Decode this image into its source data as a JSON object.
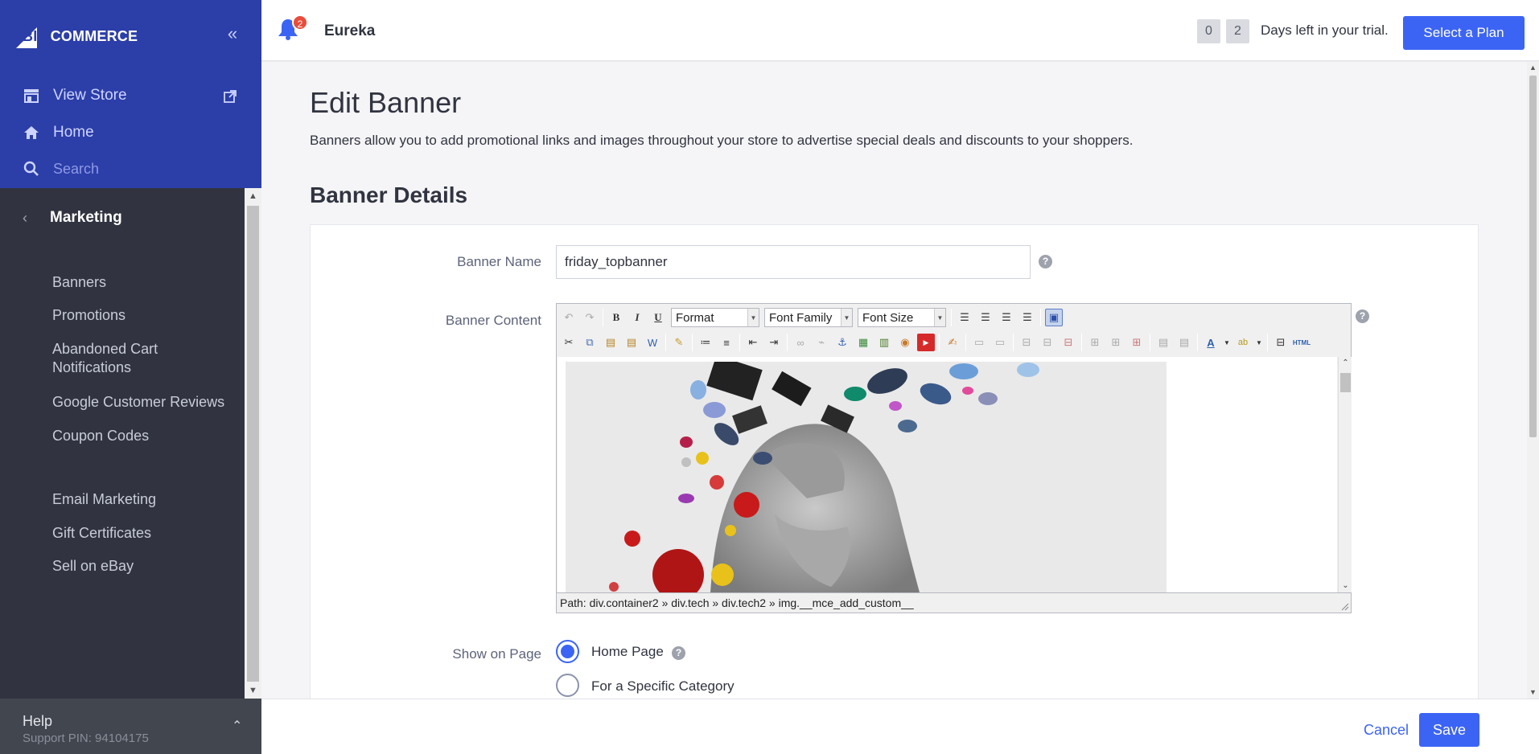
{
  "sidebar": {
    "logo_big": "BIG",
    "logo_commerce": "COMMERCE",
    "view_store": "View Store",
    "home": "Home",
    "search_placeholder": "Search",
    "section": "Marketing",
    "items": [
      "Banners",
      "Promotions",
      "Abandoned Cart",
      "Notifications",
      "Google Customer Reviews",
      "Coupon Codes",
      "Email Marketing",
      "Gift Certificates",
      "Sell on eBay"
    ],
    "help_title": "Help",
    "support_pin": "Support PIN: 94104175"
  },
  "header": {
    "notification_count": "2",
    "store_name": "Eureka",
    "trial_digit_1": "0",
    "trial_digit_2": "2",
    "trial_text": "Days left in your trial.",
    "select_plan": "Select a Plan"
  },
  "main": {
    "title": "Edit Banner",
    "description": "Banners allow you to add promotional links and images throughout your store to advertise special deals and discounts to your shoppers.",
    "section_title": "Banner Details",
    "banner_name_label": "Banner Name",
    "banner_name_value": "friday_topbanner",
    "banner_content_label": "Banner Content",
    "editor": {
      "format": "Format",
      "font_family": "Font Family",
      "font_size": "Font Size",
      "path": "Path: div.container2 » div.tech » div.tech2 » img.__mce_add_custom__"
    },
    "show_on_page_label": "Show on Page",
    "radio_home": "Home Page",
    "radio_category": "For a Specific Category",
    "radio_home_checked": true
  },
  "footer": {
    "cancel": "Cancel",
    "save": "Save"
  },
  "colors": {
    "accent": "#3c64f4",
    "sidebar_top": "#2c3ea8",
    "sidebar_dark": "#313440",
    "badge": "#ea4c3a"
  }
}
